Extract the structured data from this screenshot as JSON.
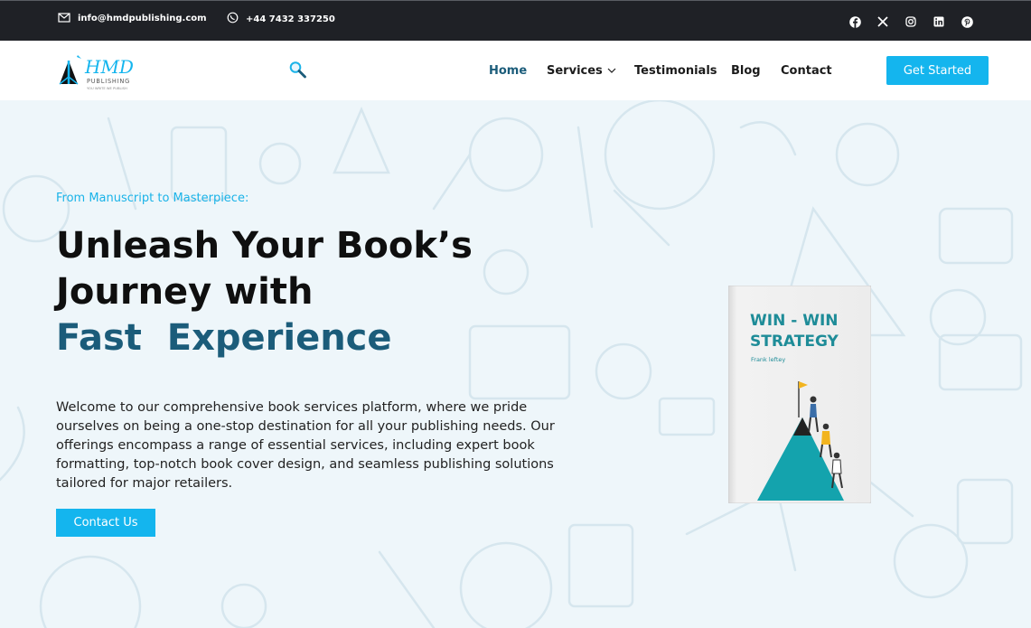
{
  "topbar": {
    "email": "info@hmdpublishing.com",
    "phone": "+44 7432 337250",
    "social_icons": [
      "facebook-icon",
      "x-icon",
      "instagram-icon",
      "linkedin-icon",
      "pinterest-icon"
    ]
  },
  "logo": {
    "mark": "HMD",
    "word": "PUBLISHING",
    "tagline": "YOU WRITE WE PUBLISH"
  },
  "nav": {
    "items": [
      "Home",
      "Services",
      "Testimonials",
      "Blog",
      "Contact"
    ],
    "active": "Home",
    "cta": "Get Started"
  },
  "hero": {
    "eyebrow": "From Manuscript to Masterpiece:",
    "headline_line1": "Unleash Your Book’s",
    "headline_line2": "Journey with",
    "headline_line3": "Fast  Experience",
    "intro": "Welcome to our comprehensive book services platform, where we pride ourselves on being a one-stop destination for all your publishing needs. Our offerings encompass a range of essential services, including expert book formatting, top-notch book cover design, and seamless publishing solutions tailored for major retailers.",
    "cta": "Contact Us"
  },
  "book": {
    "title_line1": "WIN - WIN",
    "title_line2": "STRATEGY",
    "author": "Frank leftey"
  },
  "colors": {
    "accent": "#14b5ee",
    "headline_accent": "#1b5c7a",
    "topbar": "#1f2126",
    "hero_bg": "#eef6fa"
  }
}
